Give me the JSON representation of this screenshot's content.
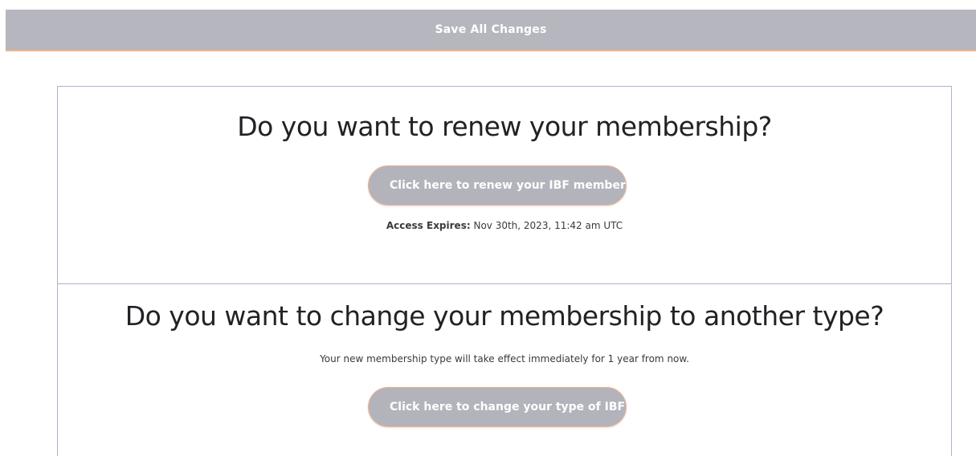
{
  "toolbar": {
    "save_all_label": "Save All Changes"
  },
  "renew_section": {
    "title": "Do you want to renew your membership?",
    "button_label": "Click here to renew your IBF membership",
    "expiry_label": "Access Expires:",
    "expiry_value": "Nov 30th, 2023, 11:42 am UTC"
  },
  "change_section": {
    "title": "Do you want to change your membership to another type?",
    "note": "Your new membership type will take effect immediately for 1 year from now.",
    "button_label": "Click here to change your type of IBF membership"
  },
  "colors": {
    "button_bg": "#b3b3bc",
    "button_border": "#f2b48c",
    "card_border": "#aeb2c8"
  }
}
